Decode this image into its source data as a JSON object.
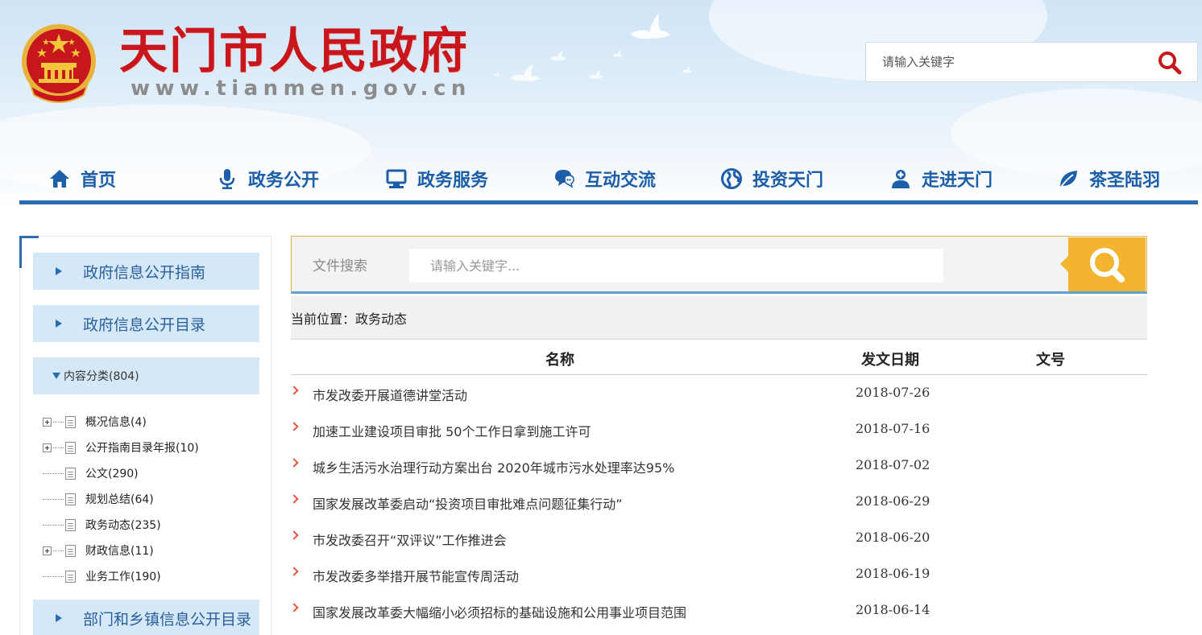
{
  "header": {
    "site_title": "天门市人民政府",
    "site_url": "www.tianmen.gov.cn",
    "search_placeholder": "请输入关键字"
  },
  "nav": {
    "items": [
      {
        "label": "首页",
        "icon": "home-icon"
      },
      {
        "label": "政务公开",
        "icon": "microphone-icon"
      },
      {
        "label": "政务服务",
        "icon": "computer-icon"
      },
      {
        "label": "互动交流",
        "icon": "chat-icon"
      },
      {
        "label": "投资天门",
        "icon": "globe-icon"
      },
      {
        "label": "走进天门",
        "icon": "person-icon"
      },
      {
        "label": "茶圣陆羽",
        "icon": "leaf-icon"
      }
    ]
  },
  "sidebar": {
    "guide_label": "政府信息公开指南",
    "catalog_label": "政府信息公开目录",
    "category_label": "内容分类(804)",
    "tree": [
      {
        "label": "概况信息(4)",
        "expandable": true
      },
      {
        "label": "公开指南目录年报(10)",
        "expandable": true
      },
      {
        "label": "公文(290)",
        "expandable": false
      },
      {
        "label": "规划总结(64)",
        "expandable": false
      },
      {
        "label": "政务动态(235)",
        "expandable": false
      },
      {
        "label": "财政信息(11)",
        "expandable": true
      },
      {
        "label": "业务工作(190)",
        "expandable": false
      }
    ],
    "dept_label": "部门和乡镇信息公开目录"
  },
  "file_search": {
    "label": "文件搜索",
    "placeholder": "请输入关键字..."
  },
  "location": "当前位置：政务动态",
  "table": {
    "columns": [
      "名称",
      "发文日期",
      "文号"
    ],
    "rows": [
      {
        "title": "市发改委开展道德讲堂活动",
        "date": "2018-07-26"
      },
      {
        "title": "加速工业建设项目审批 50个工作日拿到施工许可",
        "date": "2018-07-16"
      },
      {
        "title": "城乡生活污水治理行动方案出台 2020年城市污水处理率达95%",
        "date": "2018-07-02"
      },
      {
        "title": "国家发展改革委启动“投资项目审批难点问题征集行动”",
        "date": "2018-06-29"
      },
      {
        "title": "市发改委召开“双评议”工作推进会",
        "date": "2018-06-20"
      },
      {
        "title": "市发改委多举措开展节能宣传周活动",
        "date": "2018-06-19"
      },
      {
        "title": "国家发展改革委大幅缩小必须招标的基础设施和公用事业项目范围",
        "date": "2018-06-14"
      }
    ]
  },
  "colors": {
    "brand_red": "#c8161d",
    "nav_blue": "#1d5ea8",
    "accent_orange": "#f2b431"
  }
}
